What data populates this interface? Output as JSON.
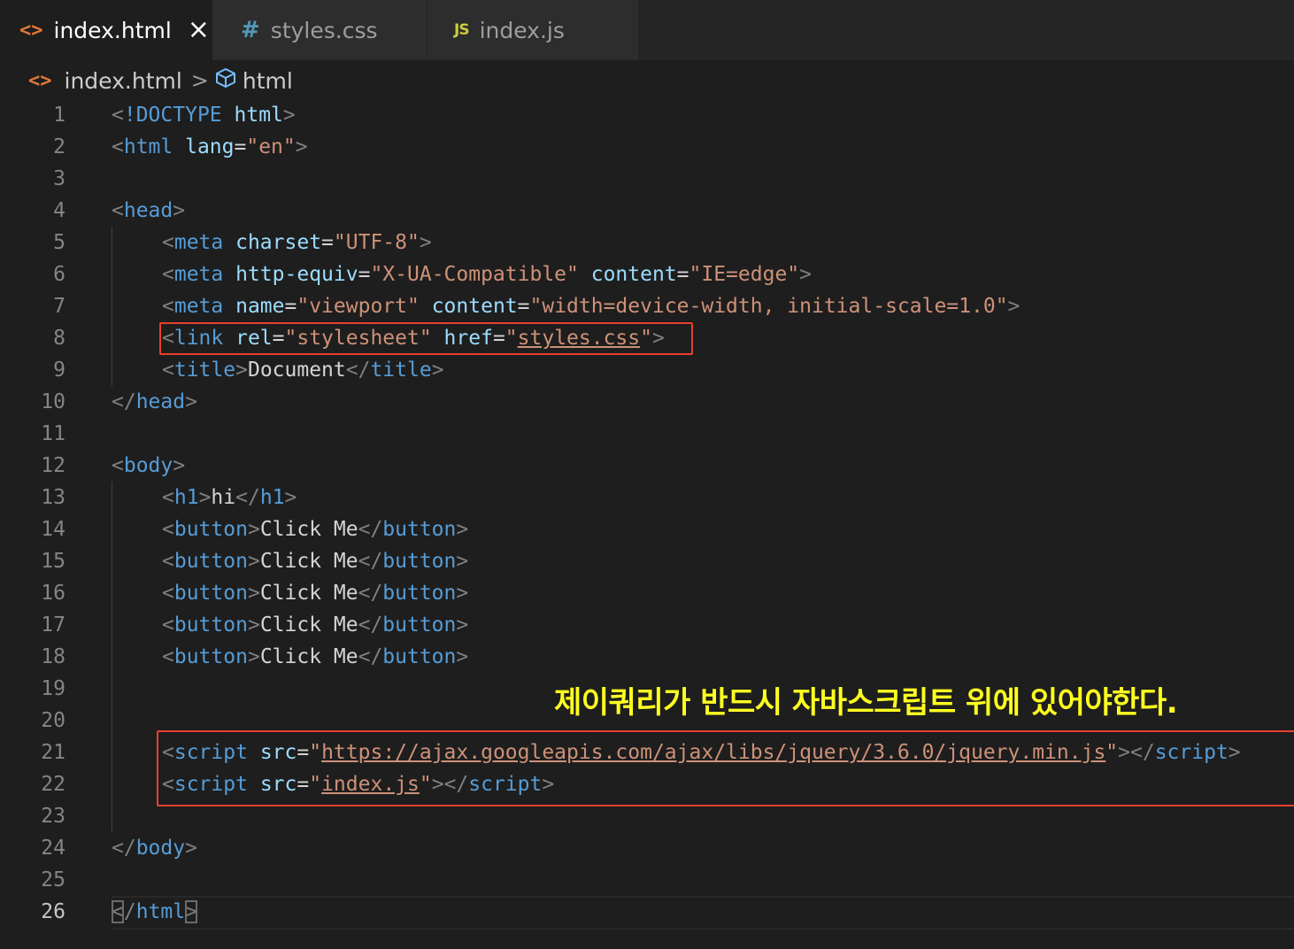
{
  "tabs": [
    {
      "icon": "html-file-icon",
      "glyph": "<>",
      "label": "index.html",
      "active": true,
      "close": "×"
    },
    {
      "icon": "css-file-icon",
      "glyph": "#",
      "label": "styles.css",
      "active": false
    },
    {
      "icon": "js-file-icon",
      "glyph": "JS",
      "label": "index.js",
      "active": false
    }
  ],
  "breadcrumb": {
    "file_glyph": "<>",
    "file": "index.html",
    "separator": ">",
    "symbol": "html"
  },
  "editor": {
    "current_line": 26,
    "lines": [
      {
        "n": "1"
      },
      {
        "n": "2"
      },
      {
        "n": "3"
      },
      {
        "n": "4"
      },
      {
        "n": "5"
      },
      {
        "n": "6"
      },
      {
        "n": "7"
      },
      {
        "n": "8"
      },
      {
        "n": "9"
      },
      {
        "n": "10"
      },
      {
        "n": "11"
      },
      {
        "n": "12"
      },
      {
        "n": "13"
      },
      {
        "n": "14"
      },
      {
        "n": "15"
      },
      {
        "n": "16"
      },
      {
        "n": "17"
      },
      {
        "n": "18"
      },
      {
        "n": "19"
      },
      {
        "n": "20"
      },
      {
        "n": "21"
      },
      {
        "n": "22"
      },
      {
        "n": "23"
      },
      {
        "n": "24"
      },
      {
        "n": "25"
      },
      {
        "n": "26"
      }
    ],
    "tokens": {
      "l1": [
        "<",
        "!DOCTYPE",
        " ",
        "html",
        ">"
      ],
      "l2": [
        "<",
        "html",
        " ",
        "lang",
        "=",
        "\"en\"",
        ">"
      ],
      "l4": [
        "<",
        "head",
        ">"
      ],
      "l5": [
        "<",
        "meta",
        " ",
        "charset",
        "=",
        "\"UTF-8\"",
        ">"
      ],
      "l6": [
        "<",
        "meta",
        " ",
        "http-equiv",
        "=",
        "\"X-UA-Compatible\"",
        " ",
        "content",
        "=",
        "\"IE=edge\"",
        ">"
      ],
      "l7": [
        "<",
        "meta",
        " ",
        "name",
        "=",
        "\"viewport\"",
        " ",
        "content",
        "=",
        "\"width=device-width, initial-scale=1.0\"",
        ">"
      ],
      "l8": [
        "<",
        "link",
        " ",
        "rel",
        "=",
        "\"stylesheet\"",
        " ",
        "href",
        "=",
        "\"",
        "styles.css",
        "\"",
        ">"
      ],
      "l9": [
        "<",
        "title",
        ">",
        "Document",
        "</",
        "title",
        ">"
      ],
      "l10": [
        "</",
        "head",
        ">"
      ],
      "l12": [
        "<",
        "body",
        ">"
      ],
      "l13": [
        "<",
        "h1",
        ">",
        "hi",
        "</",
        "h1",
        ">"
      ],
      "l14": [
        "<",
        "button",
        ">",
        "Click Me",
        "</",
        "button",
        ">"
      ],
      "l15": [
        "<",
        "button",
        ">",
        "Click Me",
        "</",
        "button",
        ">"
      ],
      "l16": [
        "<",
        "button",
        ">",
        "Click Me",
        "</",
        "button",
        ">"
      ],
      "l17": [
        "<",
        "button",
        ">",
        "Click Me",
        "</",
        "button",
        ">"
      ],
      "l18": [
        "<",
        "button",
        ">",
        "Click Me",
        "</",
        "button",
        ">"
      ],
      "l21": [
        "<",
        "script",
        " ",
        "src",
        "=",
        "\"",
        "https://ajax.googleapis.com/ajax/libs/jquery/3.6.0/jquery.min.js",
        "\"",
        "></",
        "script",
        ">"
      ],
      "l22": [
        "<",
        "script",
        " ",
        "src",
        "=",
        "\"",
        "index.js",
        "\"",
        "></",
        "script",
        ">"
      ],
      "l24": [
        "</",
        "body",
        ">"
      ],
      "l26": [
        "<",
        "/",
        "html",
        ">"
      ]
    }
  },
  "annotation": "제이쿼리가 반드시 자바스크립트 위에 있어야한다.",
  "colors": {
    "background": "#1e1e1e",
    "tag": "#569cd6",
    "attribute": "#9cdcfe",
    "string": "#ce9178",
    "highlight_box": "#e8402f",
    "annotation": "#ffff20"
  }
}
